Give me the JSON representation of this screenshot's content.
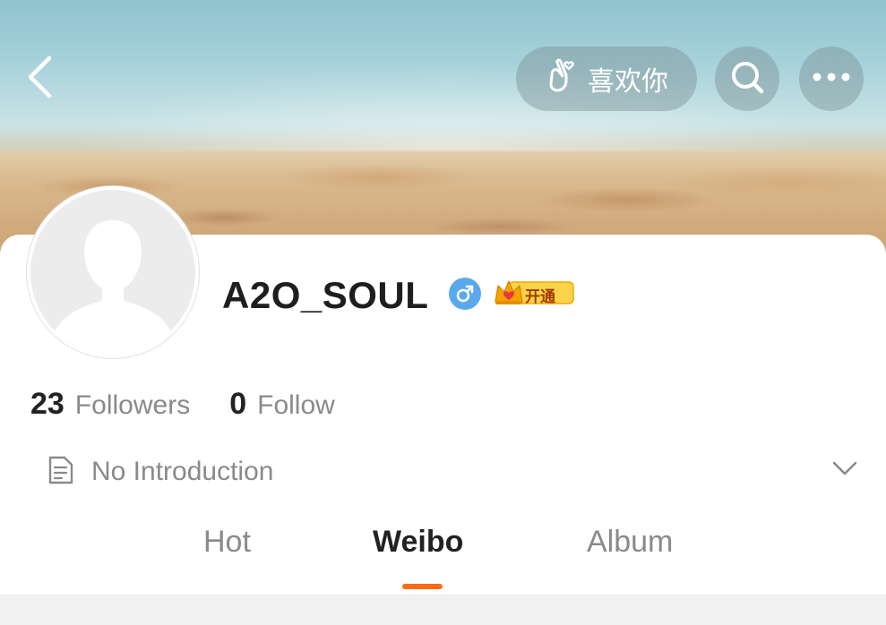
{
  "header": {
    "back_icon": "chevron-left-icon",
    "like_button_label": "喜欢你",
    "like_icon": "heart-hand-icon",
    "search_icon": "search-icon",
    "more_icon": "ellipsis-icon"
  },
  "profile": {
    "username": "A2O_SOUL",
    "gender_icon": "male-icon",
    "vip_badge_label": "开通"
  },
  "stats": {
    "followers_count": "23",
    "followers_label": "Followers",
    "follow_count": "0",
    "follow_label": "Follow"
  },
  "intro": {
    "icon": "document-icon",
    "text": "No Introduction",
    "expand_icon": "chevron-down-icon"
  },
  "tabs": [
    {
      "label": "Hot",
      "active": false
    },
    {
      "label": "Weibo",
      "active": true
    },
    {
      "label": "Album",
      "active": false
    }
  ],
  "colors": {
    "accent": "#ff6a13",
    "gender_badge": "#5aa9ec",
    "vip_gold": "#f5b800"
  }
}
